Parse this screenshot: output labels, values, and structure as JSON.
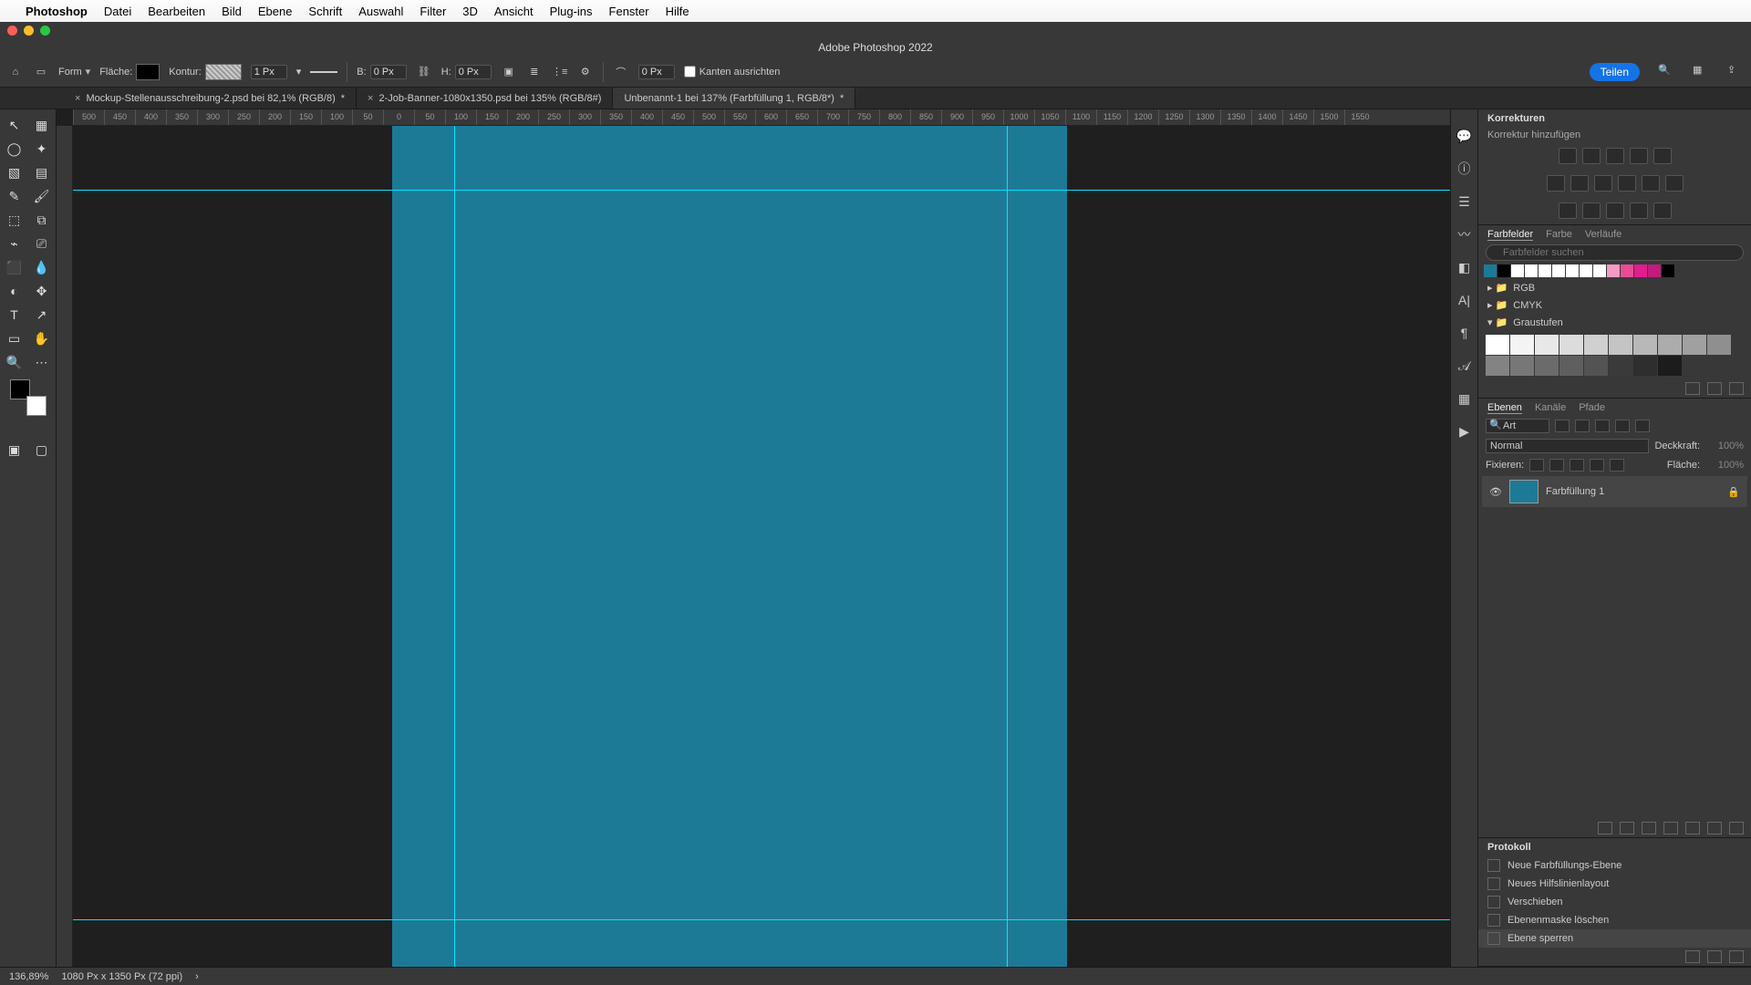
{
  "mac_menu": {
    "app": "Photoshop",
    "items": [
      "Datei",
      "Bearbeiten",
      "Bild",
      "Ebene",
      "Schrift",
      "Auswahl",
      "Filter",
      "3D",
      "Ansicht",
      "Plug-ins",
      "Fenster",
      "Hilfe"
    ]
  },
  "window_title": "Adobe Photoshop 2022",
  "options_bar": {
    "shape_mode": "Form",
    "fill_label": "Fläche:",
    "stroke_label": "Kontur:",
    "stroke_width": "1 Px",
    "w_label": "B:",
    "w_val": "0 Px",
    "h_label": "H:",
    "h_val": "0 Px",
    "radius": "0 Px",
    "align_edges": "Kanten ausrichten",
    "share": "Teilen"
  },
  "tabs": [
    {
      "label": "Mockup-Stellenausschreibung-2.psd bei 82,1% (RGB/8)",
      "dirty": "*",
      "active": false
    },
    {
      "label": "2-Job-Banner-1080x1350.psd bei 135% (RGB/8#)",
      "dirty": "",
      "active": false
    },
    {
      "label": "Unbenannt-1 bei 137% (Farbfüllung 1, RGB/8*)",
      "dirty": "*",
      "active": true
    }
  ],
  "ruler_ticks": [
    "500",
    "450",
    "400",
    "350",
    "300",
    "250",
    "200",
    "150",
    "100",
    "50",
    "0",
    "50",
    "100",
    "150",
    "200",
    "250",
    "300",
    "350",
    "400",
    "450",
    "500",
    "550",
    "600",
    "650",
    "700",
    "750",
    "800",
    "850",
    "900",
    "950",
    "1000",
    "1050",
    "1100",
    "1150",
    "1200",
    "1250",
    "1300",
    "1350",
    "1400",
    "1450",
    "1500",
    "1550"
  ],
  "adjustments": {
    "title": "Korrekturen",
    "add": "Korrektur hinzufügen"
  },
  "swatches": {
    "tabs": [
      "Farbfelder",
      "Farbe",
      "Verläufe"
    ],
    "search_placeholder": "Farbfelder suchen",
    "recent": [
      "#1d7a96",
      "#000000",
      "#ffffff",
      "#ffffff",
      "#ffffff",
      "#ffffff",
      "#ffffff",
      "#ffffff",
      "#ffffff",
      "#f59ac0",
      "#e64d94",
      "#e21d8d",
      "#c41b7d",
      "#000000"
    ],
    "groups": {
      "rgb": "RGB",
      "cmyk": "CMYK",
      "gray": "Graustufen"
    },
    "grays": [
      "#ffffff",
      "#f4f4f4",
      "#e8e8e8",
      "#dcdcdc",
      "#d0d0d0",
      "#c4c4c4",
      "#b8b8b8",
      "#acacac",
      "#a0a0a0",
      "#8f8f8f",
      "#838383",
      "#777777",
      "#6b6b6b",
      "#5f5f5f",
      "#535353",
      "#3a3a3a",
      "#2e2e2e",
      "#1c1c1c"
    ]
  },
  "layers": {
    "tabs": [
      "Ebenen",
      "Kanäle",
      "Pfade"
    ],
    "kind": "Art",
    "blend": "Normal",
    "opacity_label": "Deckkraft:",
    "opacity": "100%",
    "lock_label": "Fixieren:",
    "fill_label": "Fläche:",
    "fill": "100%",
    "layer_name": "Farbfüllung 1"
  },
  "history": {
    "title": "Protokoll",
    "items": [
      "Neue Farbfüllungs-Ebene",
      "Neues Hilfslinienlayout",
      "Verschieben",
      "Ebenenmaske löschen",
      "Ebene sperren"
    ]
  },
  "status": {
    "zoom": "136,89%",
    "doc": "1080 Px x 1350 Px (72 ppi)"
  },
  "canvas": {
    "color": "#1d7a96"
  },
  "tools": [
    "↖",
    "▦",
    "◯",
    "✦",
    "▧",
    "▤",
    "✎",
    "🖌",
    "⬚",
    "⧉",
    "⌁",
    "⎚",
    "⬛",
    "💧",
    "◐",
    "✥",
    "T",
    "↗",
    "▭",
    "✋",
    "🔍",
    "⋯"
  ]
}
